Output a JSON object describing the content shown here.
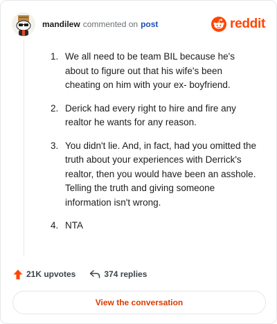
{
  "header": {
    "username": "mandilew",
    "commented_on": "commented on",
    "post_link": "post",
    "brand": "reddit",
    "brand_color": "#ff4500",
    "avatar_icon": "snoo-avatar-icon"
  },
  "comment": {
    "items": [
      {
        "number": "1.",
        "text": "We all need to be team BIL because he's about to figure out that his wife's been cheating on him with your ex- boyfriend."
      },
      {
        "number": "2.",
        "text": "Derick had every right to hire and fire any realtor he wants for any reason."
      },
      {
        "number": "3.",
        "text": "You didn't lie. And, in fact, had you omitted the truth about your experiences with Derrick's realtor, then you would have been an asshole. Telling the truth and giving someone information isn't wrong."
      },
      {
        "number": "4.",
        "text": "NTA"
      }
    ]
  },
  "actions": {
    "upvotes": "21K upvotes",
    "upvote_color": "#ff4500",
    "replies": "374 replies"
  },
  "cta": {
    "label": "View the conversation",
    "color": "#d93a00"
  }
}
